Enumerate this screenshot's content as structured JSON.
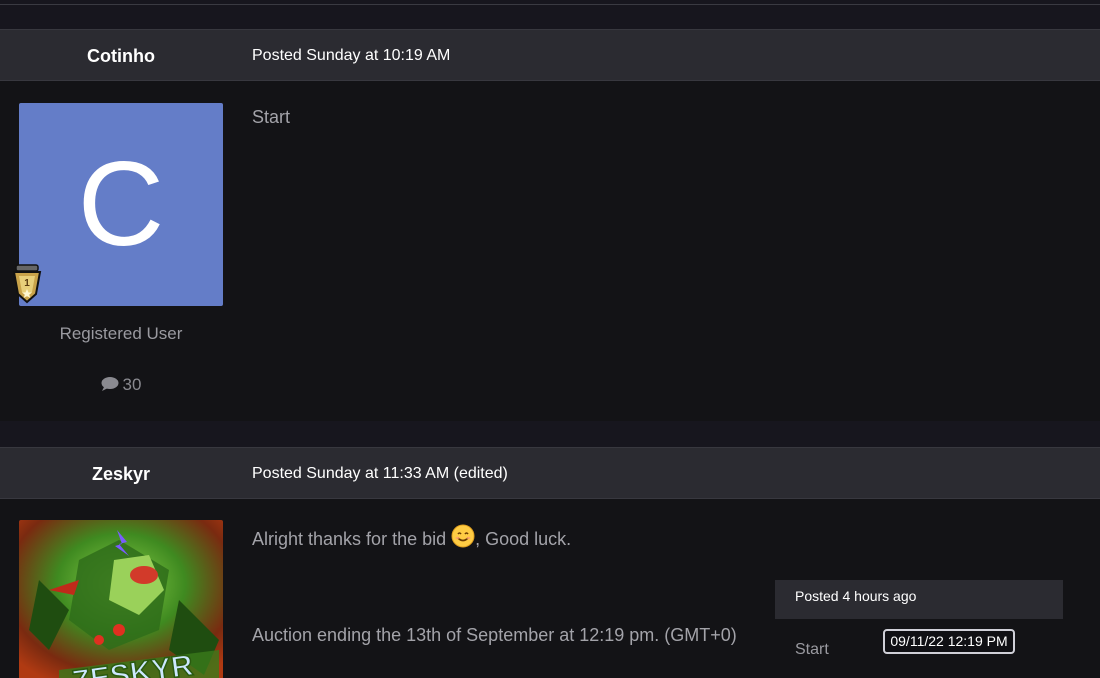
{
  "posts": [
    {
      "username": "Cotinho",
      "posted": "Posted Sunday at 10:19 AM",
      "avatar_letter": "C",
      "badge_number": "1",
      "role": "Registered User",
      "post_count": "30",
      "content": [
        "Start"
      ]
    },
    {
      "username": "Zeskyr",
      "posted": "Posted Sunday at 11:33 AM (edited)",
      "content_line1_before_emoji": "Alright thanks for the bid ",
      "content_line1_after_emoji": ", Good luck.",
      "content_line2": "Auction ending the 13th of September at 12:19 pm. (GMT+0)",
      "avatar_text": "ZESKYR"
    }
  ],
  "tooltip": {
    "header": "Posted 4 hours ago",
    "label": "Start",
    "timestamp": "09/11/22 12:19  PM"
  },
  "colors": {
    "avatar_bg": "#647dc8",
    "header_bg": "#2b2b31",
    "body_bg": "#131316"
  }
}
